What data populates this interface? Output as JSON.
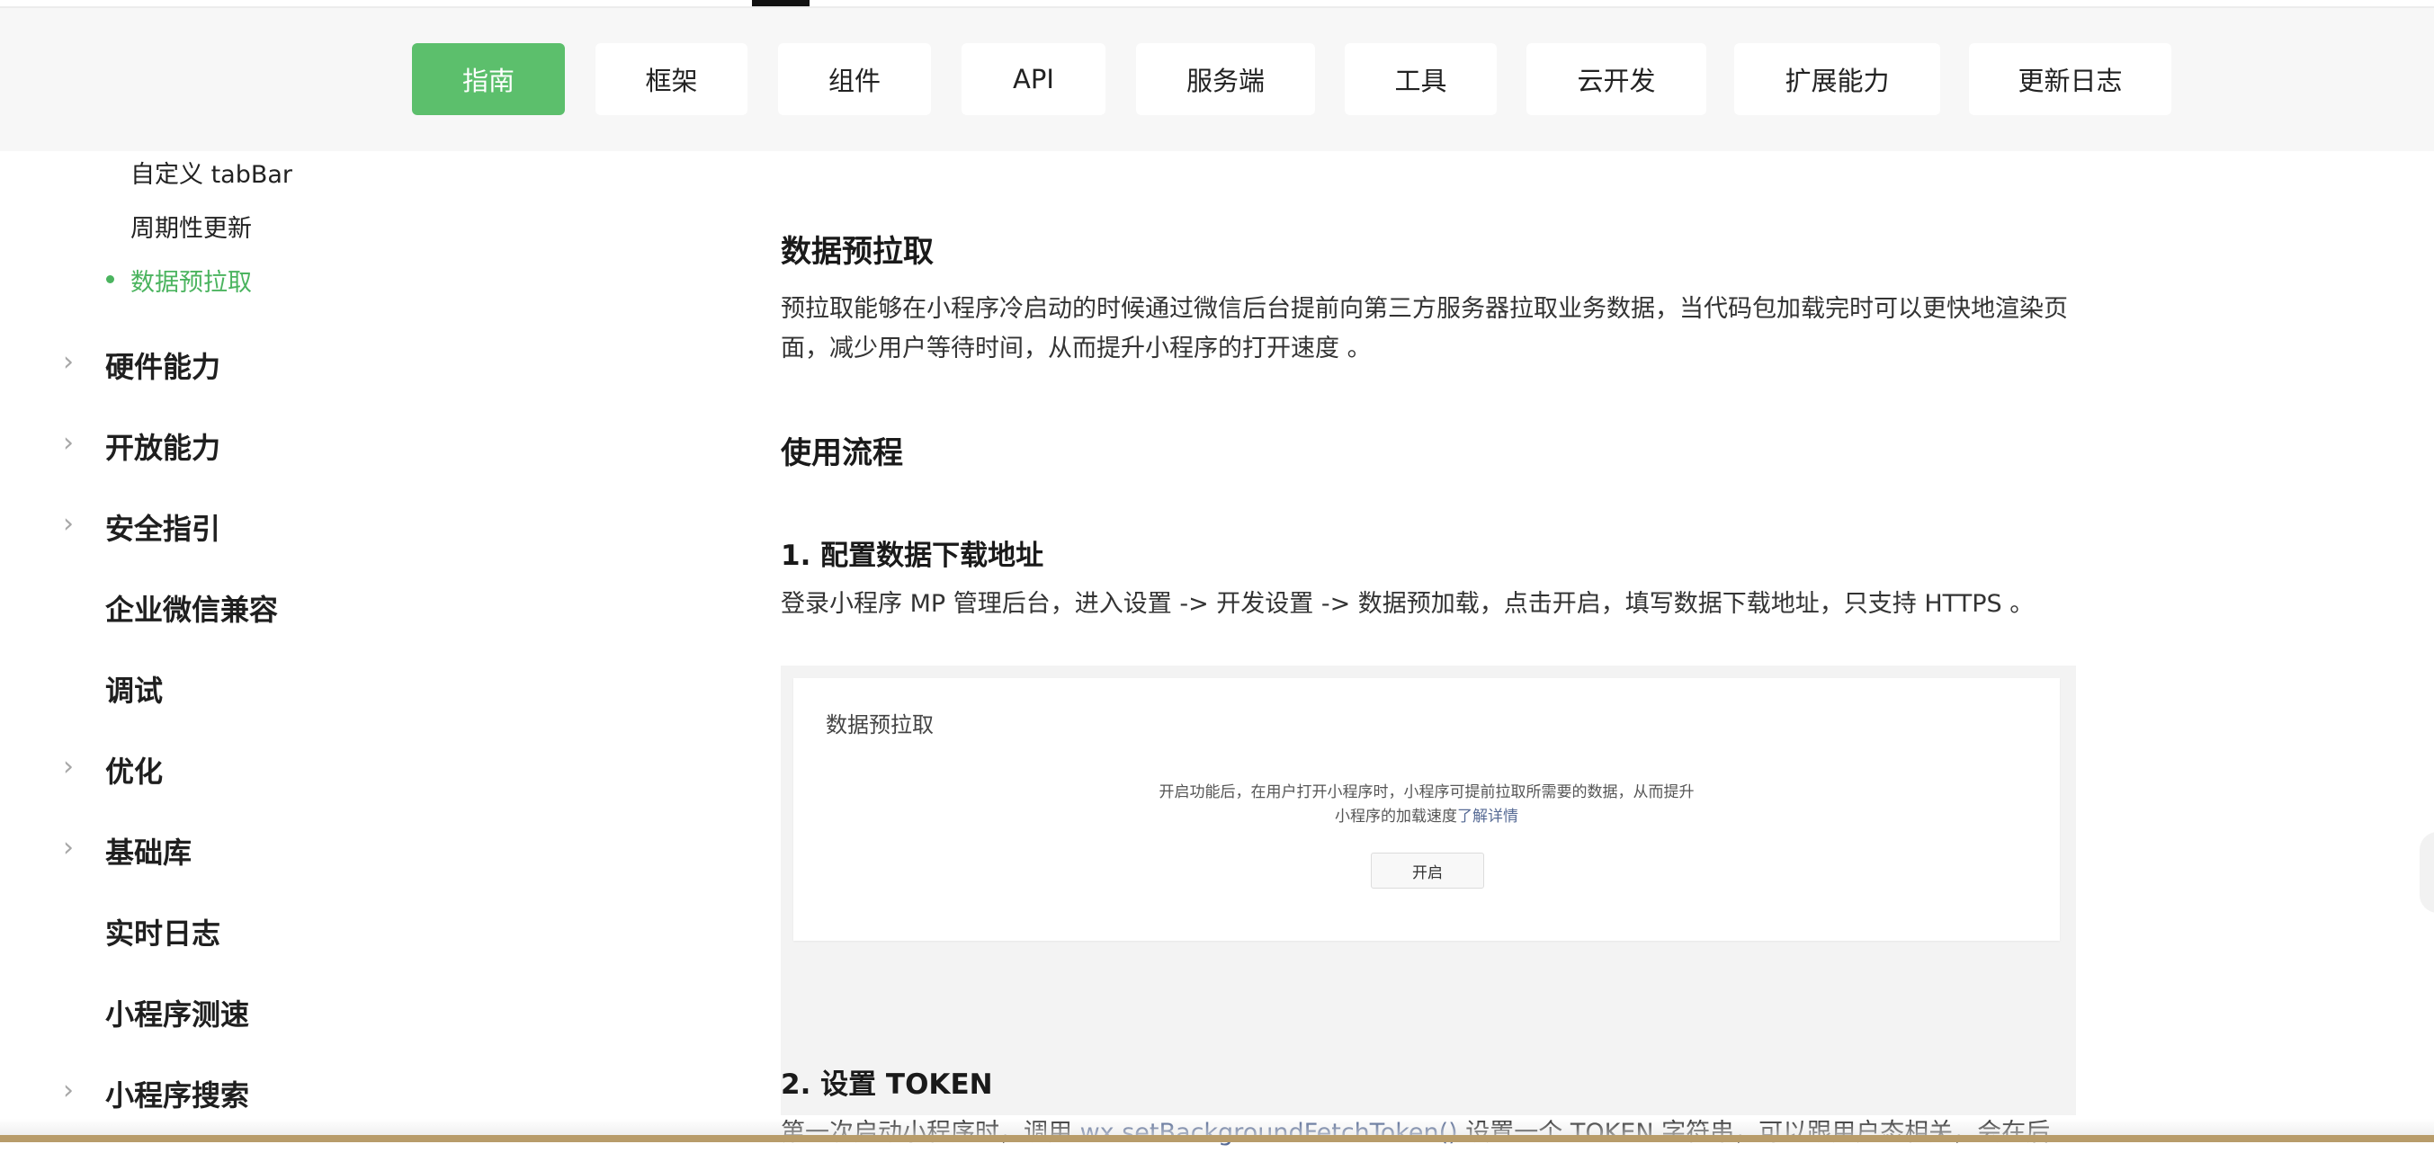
{
  "nav": {
    "tabs": [
      {
        "label": "指南",
        "active": true
      },
      {
        "label": "框架",
        "active": false
      },
      {
        "label": "组件",
        "active": false
      },
      {
        "label": "API",
        "active": false
      },
      {
        "label": "服务端",
        "active": false
      },
      {
        "label": "工具",
        "active": false
      },
      {
        "label": "云开发",
        "active": false
      },
      {
        "label": "扩展能力",
        "active": false
      },
      {
        "label": "更新日志",
        "active": false
      }
    ],
    "accent_color": "#5cbf6c"
  },
  "sidebar": {
    "sub_items": [
      {
        "label": "自定义 tabBar",
        "active": false
      },
      {
        "label": "周期性更新",
        "active": false
      },
      {
        "label": "数据预拉取",
        "active": true
      }
    ],
    "items": [
      {
        "label": "硬件能力",
        "expandable": true
      },
      {
        "label": "开放能力",
        "expandable": true
      },
      {
        "label": "安全指引",
        "expandable": true
      },
      {
        "label": "企业微信兼容",
        "expandable": false
      },
      {
        "label": "调试",
        "expandable": false
      },
      {
        "label": "优化",
        "expandable": true
      },
      {
        "label": "基础库",
        "expandable": true
      },
      {
        "label": "实时日志",
        "expandable": false
      },
      {
        "label": "小程序测速",
        "expandable": false
      },
      {
        "label": "小程序搜索",
        "expandable": true
      }
    ],
    "active_color": "#4bb45f"
  },
  "content": {
    "title": "数据预拉取",
    "intro": "预拉取能够在小程序冷启动的时候通过微信后台提前向第三方服务器拉取业务数据，当代码包加载完时可以更快地渲染页面，减少用户等待时间，从而提升小程序的打开速度 。",
    "section_title": "使用流程",
    "step1": {
      "title": "1. 配置数据下载地址",
      "text": "登录小程序 MP 管理后台，进入设置 -> 开发设置 -> 数据预加载，点击开启，填写数据下载地址，只支持 HTTPS 。"
    },
    "figure": {
      "card_title": "数据预拉取",
      "desc_line1": "开启功能后，在用户打开小程序时，小程序可提前拉取所需要的数据，从而提升",
      "desc_line2": "小程序的加载速度",
      "desc_link": "了解详情",
      "button_label": "开启"
    },
    "step2": {
      "title": "2. 设置 TOKEN",
      "text_before": "第一次启动小程序时，调用 ",
      "code": "wx.setBackgroundFetchToken()",
      "text_after": " 设置一个 TOKEN 字符串，可以跟用户态相关，会在后"
    }
  }
}
